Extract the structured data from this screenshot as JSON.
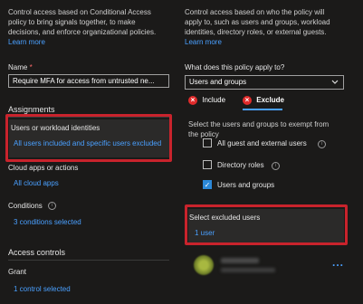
{
  "left": {
    "intro": [
      "Control access based on Conditional Access",
      "policy to bring signals together, to make",
      "decisions, and enforce organizational policies."
    ],
    "learn_more": "Learn more",
    "name_label": "Name",
    "name_required": "*",
    "name_value": "Require MFA for access from untrusted ne...",
    "assignments_heading": "Assignments",
    "users_label": "Users or workload identities",
    "users_value": "All users included and specific users excluded",
    "cloud_label": "Cloud apps or actions",
    "cloud_value": "All cloud apps",
    "conditions_label": "Conditions",
    "conditions_value": "3 conditions selected",
    "access_heading": "Access controls",
    "grant_label": "Grant",
    "grant_value": "1 control selected"
  },
  "right": {
    "intro": [
      "Control access based on who the policy will",
      "apply to, such as users and groups, workload",
      "identities, directory roles, or external guests."
    ],
    "learn_more": "Learn more",
    "apply_label": "What does this policy apply to?",
    "apply_value": "Users and groups",
    "tab_include": "Include",
    "tab_exclude": "Exclude",
    "exempt_desc": [
      "Select the users and groups to exempt from",
      "the policy"
    ],
    "options": [
      {
        "label": "All guest and external users",
        "checked": false
      },
      {
        "label": "Directory roles",
        "checked": false
      },
      {
        "label": "Users and groups",
        "checked": true
      }
    ],
    "excluded_label": "Select excluded users",
    "excluded_value": "1 user",
    "more": "..."
  },
  "colors": {
    "accent": "#4aa0ff",
    "highlight_box": "#c9232c",
    "checkbox": "#2b88d8",
    "exclude_x": "#e02b2b"
  }
}
